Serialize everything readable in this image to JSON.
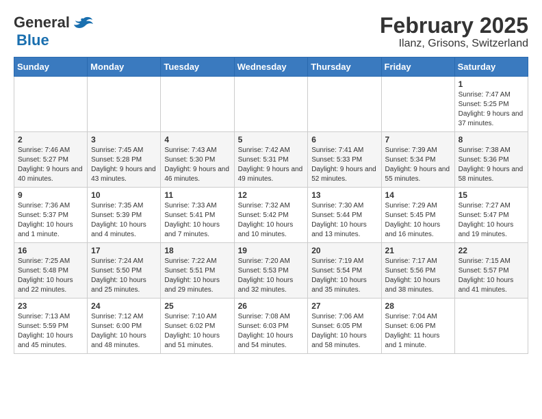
{
  "header": {
    "logo_general": "General",
    "logo_blue": "Blue",
    "title": "February 2025",
    "subtitle": "Ilanz, Grisons, Switzerland"
  },
  "calendar": {
    "days_of_week": [
      "Sunday",
      "Monday",
      "Tuesday",
      "Wednesday",
      "Thursday",
      "Friday",
      "Saturday"
    ],
    "weeks": [
      [
        {
          "day": "",
          "info": ""
        },
        {
          "day": "",
          "info": ""
        },
        {
          "day": "",
          "info": ""
        },
        {
          "day": "",
          "info": ""
        },
        {
          "day": "",
          "info": ""
        },
        {
          "day": "",
          "info": ""
        },
        {
          "day": "1",
          "info": "Sunrise: 7:47 AM\nSunset: 5:25 PM\nDaylight: 9 hours and 37 minutes."
        }
      ],
      [
        {
          "day": "2",
          "info": "Sunrise: 7:46 AM\nSunset: 5:27 PM\nDaylight: 9 hours and 40 minutes."
        },
        {
          "day": "3",
          "info": "Sunrise: 7:45 AM\nSunset: 5:28 PM\nDaylight: 9 hours and 43 minutes."
        },
        {
          "day": "4",
          "info": "Sunrise: 7:43 AM\nSunset: 5:30 PM\nDaylight: 9 hours and 46 minutes."
        },
        {
          "day": "5",
          "info": "Sunrise: 7:42 AM\nSunset: 5:31 PM\nDaylight: 9 hours and 49 minutes."
        },
        {
          "day": "6",
          "info": "Sunrise: 7:41 AM\nSunset: 5:33 PM\nDaylight: 9 hours and 52 minutes."
        },
        {
          "day": "7",
          "info": "Sunrise: 7:39 AM\nSunset: 5:34 PM\nDaylight: 9 hours and 55 minutes."
        },
        {
          "day": "8",
          "info": "Sunrise: 7:38 AM\nSunset: 5:36 PM\nDaylight: 9 hours and 58 minutes."
        }
      ],
      [
        {
          "day": "9",
          "info": "Sunrise: 7:36 AM\nSunset: 5:37 PM\nDaylight: 10 hours and 1 minute."
        },
        {
          "day": "10",
          "info": "Sunrise: 7:35 AM\nSunset: 5:39 PM\nDaylight: 10 hours and 4 minutes."
        },
        {
          "day": "11",
          "info": "Sunrise: 7:33 AM\nSunset: 5:41 PM\nDaylight: 10 hours and 7 minutes."
        },
        {
          "day": "12",
          "info": "Sunrise: 7:32 AM\nSunset: 5:42 PM\nDaylight: 10 hours and 10 minutes."
        },
        {
          "day": "13",
          "info": "Sunrise: 7:30 AM\nSunset: 5:44 PM\nDaylight: 10 hours and 13 minutes."
        },
        {
          "day": "14",
          "info": "Sunrise: 7:29 AM\nSunset: 5:45 PM\nDaylight: 10 hours and 16 minutes."
        },
        {
          "day": "15",
          "info": "Sunrise: 7:27 AM\nSunset: 5:47 PM\nDaylight: 10 hours and 19 minutes."
        }
      ],
      [
        {
          "day": "16",
          "info": "Sunrise: 7:25 AM\nSunset: 5:48 PM\nDaylight: 10 hours and 22 minutes."
        },
        {
          "day": "17",
          "info": "Sunrise: 7:24 AM\nSunset: 5:50 PM\nDaylight: 10 hours and 25 minutes."
        },
        {
          "day": "18",
          "info": "Sunrise: 7:22 AM\nSunset: 5:51 PM\nDaylight: 10 hours and 29 minutes."
        },
        {
          "day": "19",
          "info": "Sunrise: 7:20 AM\nSunset: 5:53 PM\nDaylight: 10 hours and 32 minutes."
        },
        {
          "day": "20",
          "info": "Sunrise: 7:19 AM\nSunset: 5:54 PM\nDaylight: 10 hours and 35 minutes."
        },
        {
          "day": "21",
          "info": "Sunrise: 7:17 AM\nSunset: 5:56 PM\nDaylight: 10 hours and 38 minutes."
        },
        {
          "day": "22",
          "info": "Sunrise: 7:15 AM\nSunset: 5:57 PM\nDaylight: 10 hours and 41 minutes."
        }
      ],
      [
        {
          "day": "23",
          "info": "Sunrise: 7:13 AM\nSunset: 5:59 PM\nDaylight: 10 hours and 45 minutes."
        },
        {
          "day": "24",
          "info": "Sunrise: 7:12 AM\nSunset: 6:00 PM\nDaylight: 10 hours and 48 minutes."
        },
        {
          "day": "25",
          "info": "Sunrise: 7:10 AM\nSunset: 6:02 PM\nDaylight: 10 hours and 51 minutes."
        },
        {
          "day": "26",
          "info": "Sunrise: 7:08 AM\nSunset: 6:03 PM\nDaylight: 10 hours and 54 minutes."
        },
        {
          "day": "27",
          "info": "Sunrise: 7:06 AM\nSunset: 6:05 PM\nDaylight: 10 hours and 58 minutes."
        },
        {
          "day": "28",
          "info": "Sunrise: 7:04 AM\nSunset: 6:06 PM\nDaylight: 11 hours and 1 minute."
        },
        {
          "day": "",
          "info": ""
        }
      ]
    ]
  }
}
